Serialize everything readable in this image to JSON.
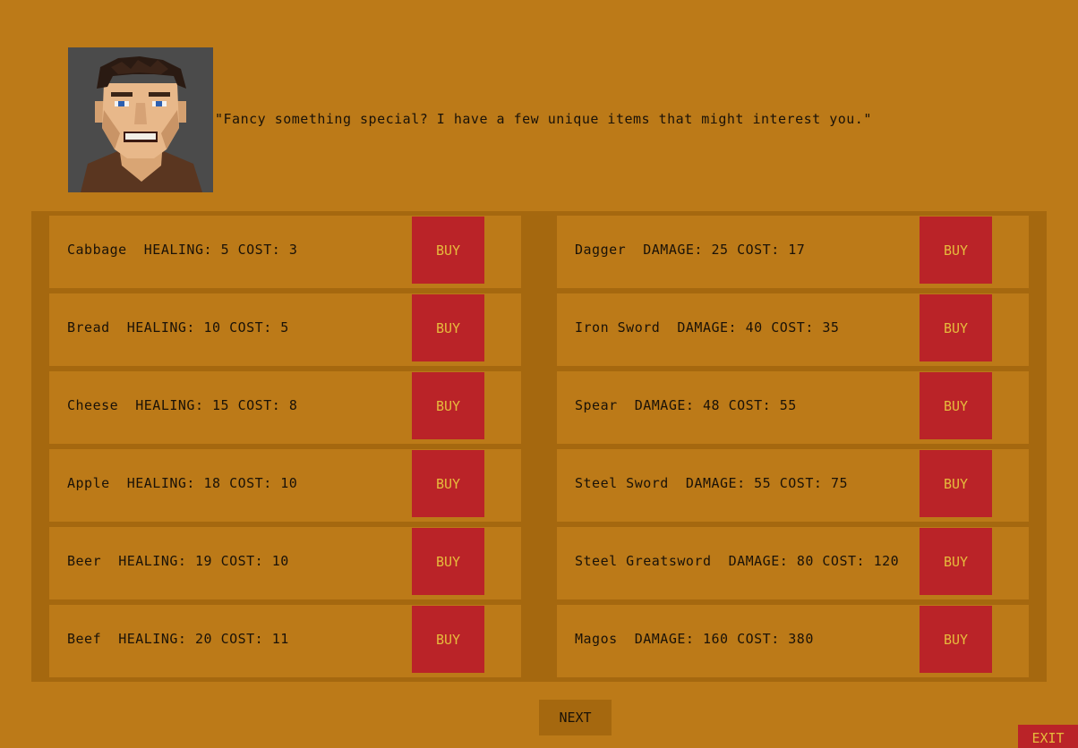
{
  "merchant": {
    "dialogue": "\"Fancy something special? I have a few unique items that might interest you.\""
  },
  "shop": {
    "food": [
      {
        "name": "Cabbage",
        "stat_label": "HEALING:",
        "stat_value": 5,
        "cost_label": "COST:",
        "cost": 3,
        "buy_label": "BUY"
      },
      {
        "name": "Bread",
        "stat_label": "HEALING:",
        "stat_value": 10,
        "cost_label": "COST:",
        "cost": 5,
        "buy_label": "BUY"
      },
      {
        "name": "Cheese",
        "stat_label": "HEALING:",
        "stat_value": 15,
        "cost_label": "COST:",
        "cost": 8,
        "buy_label": "BUY"
      },
      {
        "name": "Apple",
        "stat_label": "HEALING:",
        "stat_value": 18,
        "cost_label": "COST:",
        "cost": 10,
        "buy_label": "BUY"
      },
      {
        "name": "Beer",
        "stat_label": "HEALING:",
        "stat_value": 19,
        "cost_label": "COST:",
        "cost": 10,
        "buy_label": "BUY"
      },
      {
        "name": "Beef",
        "stat_label": "HEALING:",
        "stat_value": 20,
        "cost_label": "COST:",
        "cost": 11,
        "buy_label": "BUY"
      }
    ],
    "weapons": [
      {
        "name": "Dagger",
        "stat_label": "DAMAGE:",
        "stat_value": 25,
        "cost_label": "COST:",
        "cost": 17,
        "buy_label": "BUY"
      },
      {
        "name": "Iron Sword",
        "stat_label": "DAMAGE:",
        "stat_value": 40,
        "cost_label": "COST:",
        "cost": 35,
        "buy_label": "BUY"
      },
      {
        "name": "Spear",
        "stat_label": "DAMAGE:",
        "stat_value": 48,
        "cost_label": "COST:",
        "cost": 55,
        "buy_label": "BUY"
      },
      {
        "name": "Steel Sword",
        "stat_label": "DAMAGE:",
        "stat_value": 55,
        "cost_label": "COST:",
        "cost": 75,
        "buy_label": "BUY"
      },
      {
        "name": "Steel Greatsword",
        "stat_label": "DAMAGE:",
        "stat_value": 80,
        "cost_label": "COST:",
        "cost": 120,
        "buy_label": "BUY"
      },
      {
        "name": "Magos",
        "stat_label": "DAMAGE:",
        "stat_value": 160,
        "cost_label": "COST:",
        "cost": 380,
        "buy_label": "BUY"
      }
    ]
  },
  "nav": {
    "next_label": "NEXT",
    "exit_label": "EXIT"
  },
  "colors": {
    "background": "#bc7a18",
    "panel": "#a5680f",
    "buy_button": "#ba2328",
    "buy_text": "#e6bb3c",
    "text": "#1a1208"
  }
}
